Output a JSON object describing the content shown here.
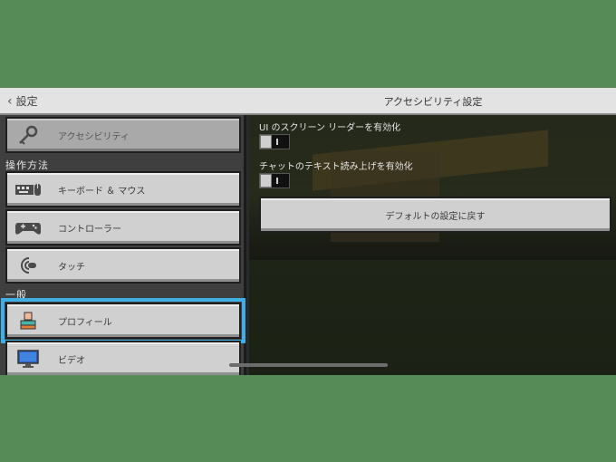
{
  "header": {
    "back_label": "設定",
    "title": "アクセシビリティ設定"
  },
  "sidebar": {
    "items": [
      {
        "label": "アクセシビリティ",
        "icon": "key-icon"
      },
      {
        "label": "キーボード ＆ マウス",
        "icon": "keyboard-mouse-icon"
      },
      {
        "label": "コントローラー",
        "icon": "controller-icon"
      },
      {
        "label": "タッチ",
        "icon": "touch-icon"
      },
      {
        "label": "プロフィール",
        "icon": "profile-icon"
      },
      {
        "label": "ビデオ",
        "icon": "monitor-icon"
      }
    ],
    "sections": {
      "controls": "操作方法",
      "general": "一般"
    }
  },
  "options": {
    "ui_reader": {
      "label": "UI のスクリーン リーダーを有効化",
      "enabled": false
    },
    "chat_tts": {
      "label": "チャットのテキスト読み上げを有効化",
      "enabled": false
    },
    "reset_button": "デフォルトの設定に戻す"
  },
  "colors": {
    "background": "#568a57",
    "selection_highlight": "#3fb0e6",
    "button_face": "#d0d0d0"
  }
}
